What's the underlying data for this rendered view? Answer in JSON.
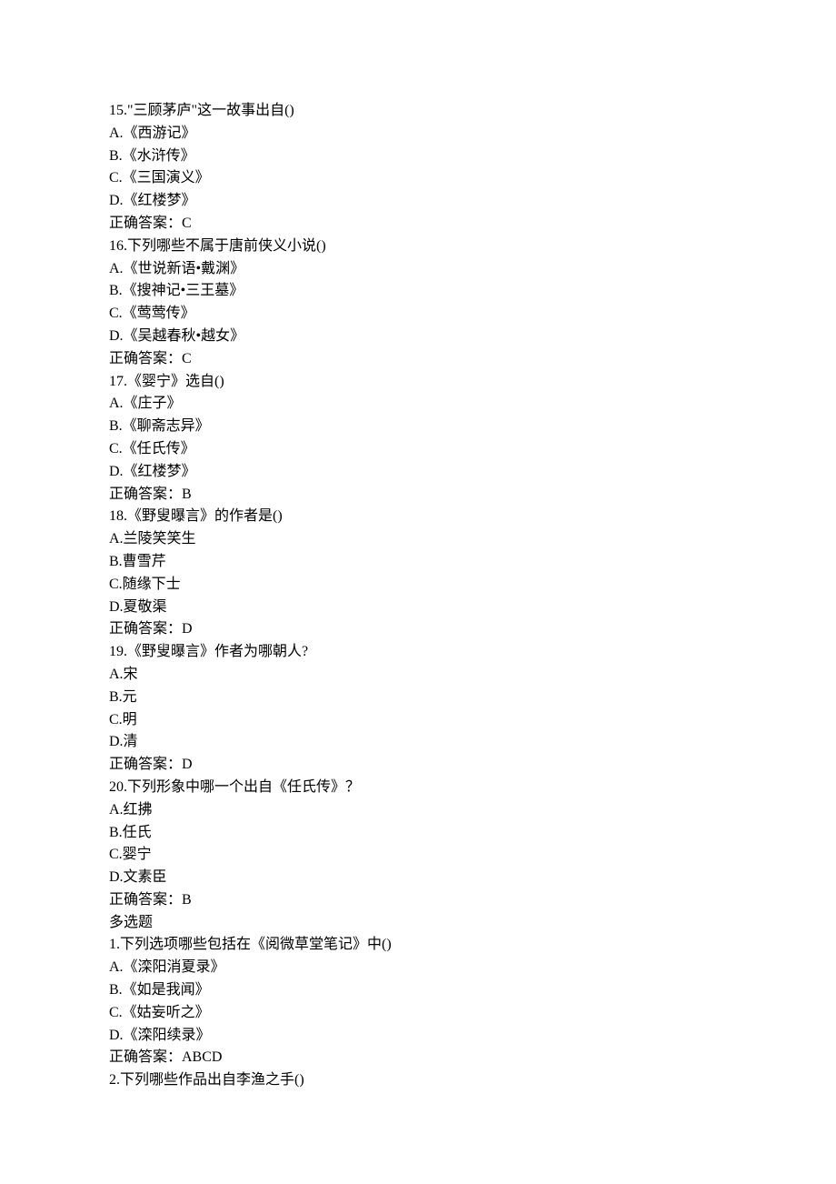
{
  "single_choice": [
    {
      "number": "15.",
      "stem": "\"三顾茅庐\"这一故事出自()",
      "options": [
        {
          "letter": "A.",
          "text": "《西游记》"
        },
        {
          "letter": "B.",
          "text": "《水浒传》"
        },
        {
          "letter": "C.",
          "text": "《三国演义》"
        },
        {
          "letter": "D.",
          "text": "《红楼梦》"
        }
      ],
      "answer_label": "正确答案：",
      "answer_value": "C"
    },
    {
      "number": "16.",
      "stem": "下列哪些不属于唐前侠义小说()",
      "options": [
        {
          "letter": "A.",
          "text": "《世说新语•戴渊》"
        },
        {
          "letter": "B.",
          "text": "《搜神记•三王墓》"
        },
        {
          "letter": "C.",
          "text": "《莺莺传》"
        },
        {
          "letter": "D.",
          "text": "《吴越春秋•越女》"
        }
      ],
      "answer_label": "正确答案：",
      "answer_value": "C"
    },
    {
      "number": "17.",
      "stem": "《婴宁》选自()",
      "options": [
        {
          "letter": "A.",
          "text": "《庄子》"
        },
        {
          "letter": "B.",
          "text": "《聊斋志异》"
        },
        {
          "letter": "C.",
          "text": "《任氏传》"
        },
        {
          "letter": "D.",
          "text": "《红楼梦》"
        }
      ],
      "answer_label": "正确答案：",
      "answer_value": "B"
    },
    {
      "number": "18.",
      "stem": "《野叟曝言》的作者是()",
      "options": [
        {
          "letter": "A.",
          "text": "兰陵笑笑生"
        },
        {
          "letter": "B.",
          "text": "曹雪芹"
        },
        {
          "letter": "C.",
          "text": "随缘下士"
        },
        {
          "letter": "D.",
          "text": "夏敬渠"
        }
      ],
      "answer_label": "正确答案：",
      "answer_value": "D"
    },
    {
      "number": "19.",
      "stem": "《野叟曝言》作者为哪朝人?",
      "options": [
        {
          "letter": "A.",
          "text": "宋"
        },
        {
          "letter": "B.",
          "text": "元"
        },
        {
          "letter": "C.",
          "text": "明"
        },
        {
          "letter": "D.",
          "text": "清"
        }
      ],
      "answer_label": "正确答案：",
      "answer_value": "D"
    },
    {
      "number": "20.",
      "stem": "下列形象中哪一个出自《任氏传》？",
      "options": [
        {
          "letter": "A.",
          "text": "红拂"
        },
        {
          "letter": "B.",
          "text": "任氏"
        },
        {
          "letter": "C.",
          "text": "婴宁"
        },
        {
          "letter": "D.",
          "text": "文素臣"
        }
      ],
      "answer_label": "正确答案：",
      "answer_value": "B"
    }
  ],
  "multi_heading": "多选题",
  "multi_choice": [
    {
      "number": "1.",
      "stem": "下列选项哪些包括在《阅微草堂笔记》中()",
      "options": [
        {
          "letter": "A.",
          "text": "《滦阳消夏录》"
        },
        {
          "letter": "B.",
          "text": "《如是我闻》"
        },
        {
          "letter": "C.",
          "text": "《姑妄听之》"
        },
        {
          "letter": "D.",
          "text": "《滦阳续录》"
        }
      ],
      "answer_label": "正确答案：",
      "answer_value": "ABCD"
    },
    {
      "number": "2.",
      "stem": "下列哪些作品出自李渔之手()",
      "options": [],
      "answer_label": "",
      "answer_value": ""
    }
  ]
}
